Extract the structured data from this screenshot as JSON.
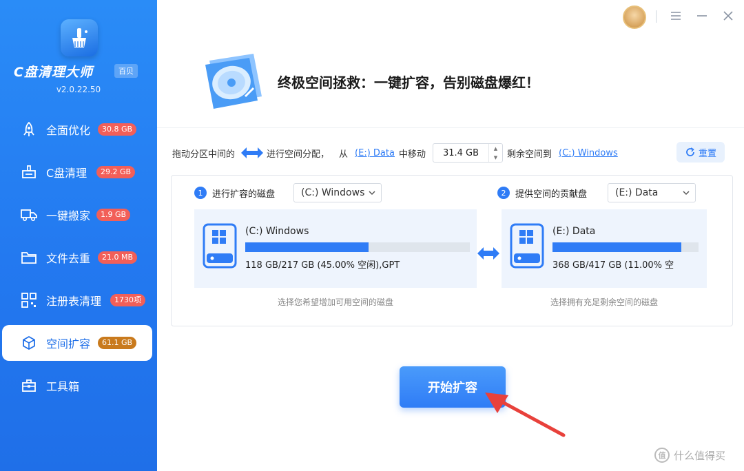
{
  "app": {
    "name": "C盘清理大师",
    "edition": "百贝",
    "version": "v2.0.22.50"
  },
  "sidebar": {
    "items": [
      {
        "label": "全面优化",
        "badge": "30.8 GB",
        "icon": "rocket-icon"
      },
      {
        "label": "C盘清理",
        "badge": "29.2 GB",
        "icon": "broom-icon"
      },
      {
        "label": "一键搬家",
        "badge": "1.9 GB",
        "icon": "truck-icon"
      },
      {
        "label": "文件去重",
        "badge": "21.0 MB",
        "icon": "folder-icon"
      },
      {
        "label": "注册表清理",
        "badge": "1730项",
        "icon": "qr-grid-icon"
      },
      {
        "label": "空间扩容",
        "badge": "61.1 GB",
        "icon": "cube-icon",
        "active": true
      },
      {
        "label": "工具箱",
        "badge": "",
        "icon": "toolbox-icon"
      }
    ]
  },
  "header": {
    "title": "终极空间拯救：一键扩容，告别磁盘爆红！"
  },
  "instruction": {
    "part1": "拖动分区中间的",
    "part2": "进行空间分配，",
    "from": "从",
    "source_link": "(E:) Data",
    "move": "中移动",
    "amount": "31.4 GB",
    "remaining_to": "剩余空间到",
    "target_link": "(C:) Windows",
    "reset_label": "重置"
  },
  "expand_section": {
    "number": "1",
    "label": "进行扩容的磁盘",
    "selected": "(C:) Windows",
    "disk": {
      "name": "(C:) Windows",
      "info": "118 GB/217 GB (45.00% 空闲),GPT",
      "used_fraction": 0.55
    },
    "hint": "选择您希望增加可用空间的磁盘"
  },
  "donor_section": {
    "number": "2",
    "label": "提供空间的贡献盘",
    "selected": "(E:) Data",
    "disk": {
      "name": "(E:) Data",
      "info": "368 GB/417 GB (11.00% 空",
      "used_fraction": 0.88
    },
    "hint": "选择拥有充足剩余空间的磁盘"
  },
  "start_button": "开始扩容",
  "watermark": {
    "badge": "值",
    "text": "什么值得买"
  },
  "colors": {
    "accent": "#2f7cf6",
    "sidebar": "#2379f0",
    "badge_red": "#f25f58",
    "badge_active": "#c97a1d",
    "arrow_red": "#e8413b"
  }
}
